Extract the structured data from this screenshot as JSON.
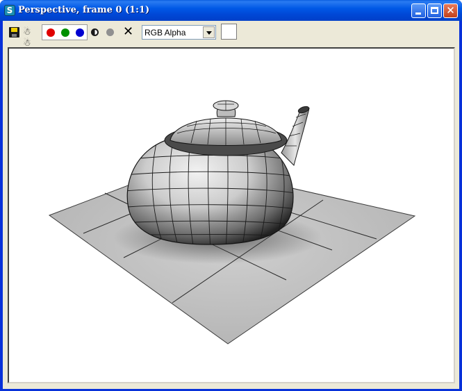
{
  "window": {
    "title": "Perspective, frame 0 (1:1)",
    "app_icon_glyph": "S",
    "buttons": {
      "minimize": "minimize",
      "maximize": "maximize",
      "close": "close"
    }
  },
  "toolbar": {
    "icons": [
      "save-icon",
      "clone-window-icon",
      "red-channel-icon",
      "green-channel-icon",
      "blue-channel-icon",
      "monochrome-icon",
      "alpha-channel-icon",
      "clear-icon"
    ],
    "channel_select": {
      "value": "RGB Alpha"
    },
    "swatch_color": "#ffffff"
  },
  "colors": {
    "title_bar": "#0058e6",
    "window_frame": "#0831d9",
    "toolbar_bg": "#ece9d8",
    "red_channel": "#e00000",
    "green_channel": "#009000",
    "blue_channel": "#0000d0"
  },
  "render": {
    "subject": "wireframe teapot",
    "background": "#ffffff"
  }
}
